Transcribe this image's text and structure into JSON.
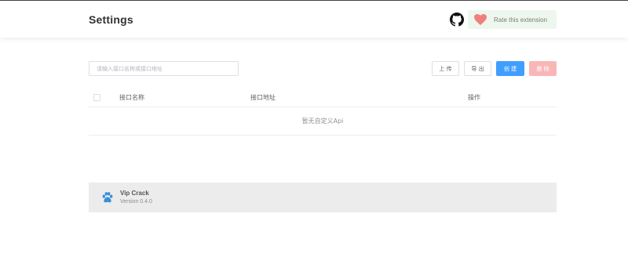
{
  "header": {
    "title": "Settings",
    "rate_label": "Rate this extension"
  },
  "toolbar": {
    "search_placeholder": "请输入接口名称或接口地址",
    "upload_label": "上 传",
    "export_label": "导 出",
    "create_label": "创 建",
    "delete_label": "删 除"
  },
  "table": {
    "columns": [
      "接口名称",
      "接口地址",
      "操作"
    ],
    "empty_text": "暂无自定义Api"
  },
  "footer": {
    "app_name": "Vip Crack",
    "version": "Version 0.4.0"
  },
  "colors": {
    "primary": "#409eff",
    "danger_disabled": "#fab6b6",
    "rate_bg": "#eef7ee",
    "heart": "#f08080",
    "paw": "#3a8fd8"
  },
  "icons": [
    "github-icon",
    "heart-icon",
    "paw-icon"
  ]
}
